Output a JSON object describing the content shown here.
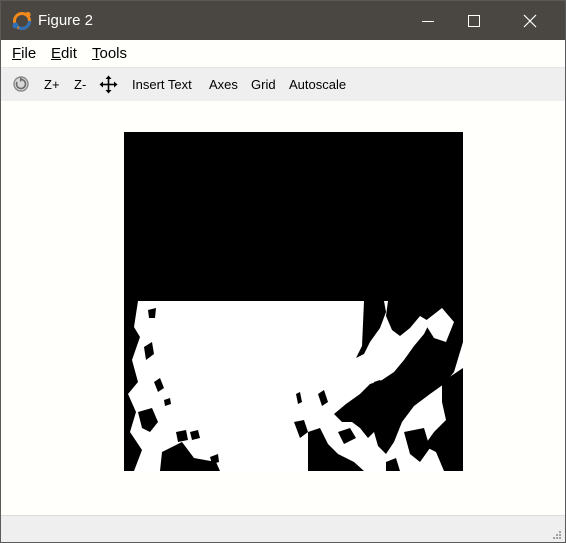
{
  "window": {
    "title": "Figure 2",
    "icon": "octave-logo-icon",
    "controls": [
      "minimize-icon",
      "maximize-icon",
      "close-icon"
    ]
  },
  "menu": {
    "file_prefix": "",
    "file_mnemonic": "F",
    "file_rest": "ile",
    "edit_mnemonic": "E",
    "edit_rest": "dit",
    "tools_mnemonic": "T",
    "tools_rest": "ools"
  },
  "toolbar": {
    "rotate_icon": "rotate-3d-icon",
    "zoom_in": "Z+",
    "zoom_out": "Z-",
    "pan_icon": "pan-move-icon",
    "insert_text": "Insert Text",
    "axes": "Axes",
    "grid": "Grid",
    "autoscale": "Autoscale"
  },
  "figure": {
    "content": "binary-image",
    "colors": {
      "foreground": "#000000",
      "background": "#ffffff"
    }
  },
  "colors": {
    "titlebar": "#4a4743",
    "toolbar": "#efefef",
    "canvas": "#fffffc"
  }
}
